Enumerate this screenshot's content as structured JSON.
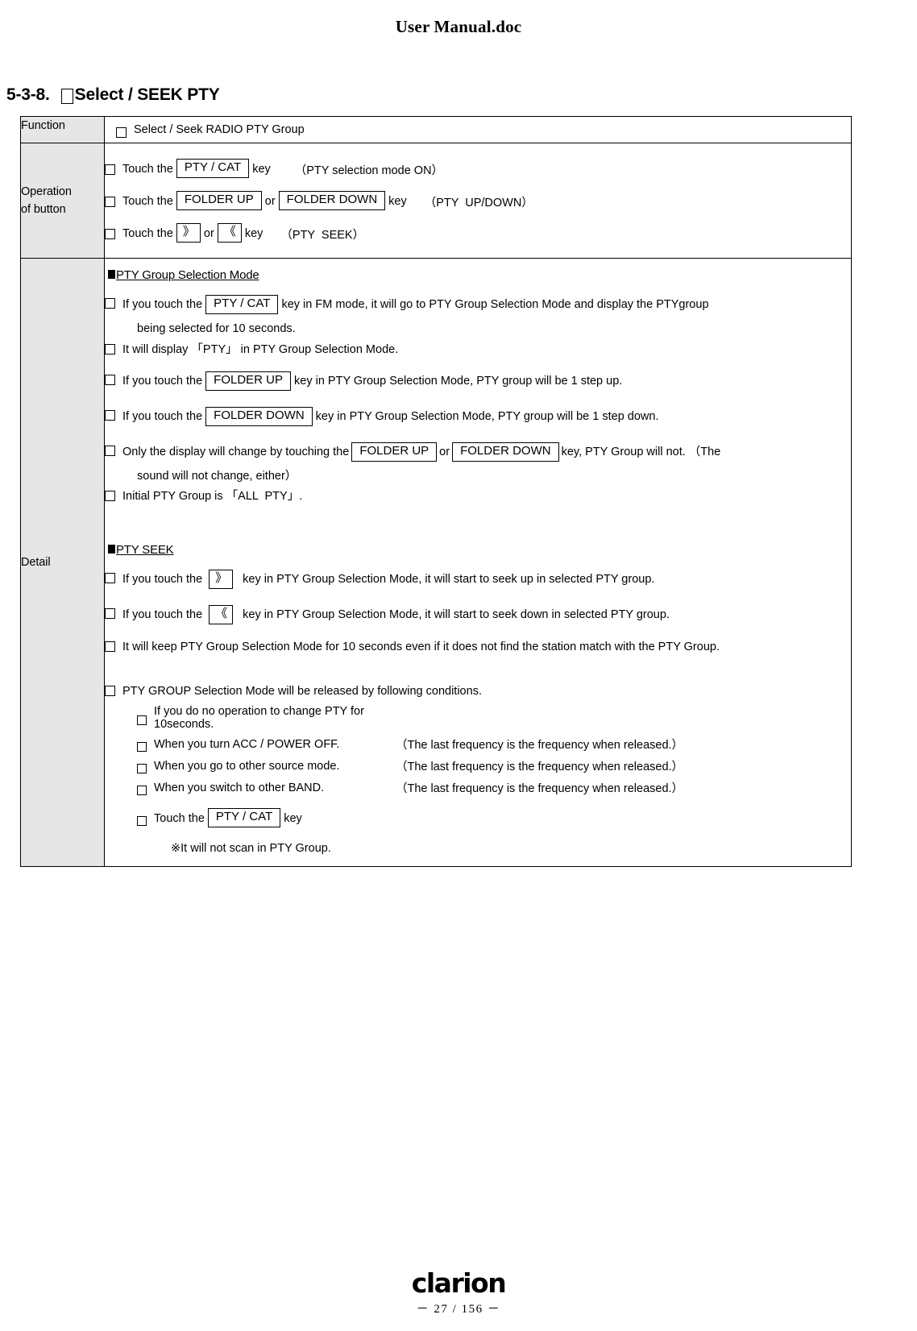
{
  "document": {
    "header_title": "User Manual.doc"
  },
  "section": {
    "number": "5-3-8.",
    "title": "Select / SEEK  PTY"
  },
  "table": {
    "rows": {
      "function": {
        "label": "Function",
        "value": "Select / Seek RADIO PTY Group"
      },
      "operation": {
        "label_line1": "Operation",
        "label_line2": "of button",
        "items": [
          {
            "prefix": "Touch the",
            "key1": "PTY / CAT",
            "mid": "",
            "key2": "",
            "suffix": "key",
            "note": "（PTY selection mode ON）"
          },
          {
            "prefix": "Touch the",
            "key1": "FOLDER UP",
            "mid": "or",
            "key2": "FOLDER DOWN",
            "suffix": "key",
            "note": "（PTY  UP/DOWN）"
          },
          {
            "prefix": "Touch the",
            "key1": "》",
            "mid": "or",
            "key2": "《",
            "suffix": "key",
            "note": "（PTY  SEEK）"
          }
        ]
      },
      "detail": {
        "label": "Detail",
        "group_heading": "PTY Group Selection Mode",
        "group_items": {
          "item1_a": "If you touch the",
          "item1_key": "PTY / CAT",
          "item1_b": "key in FM mode, it will go to PTY Group Selection Mode and display the PTYgroup",
          "item1_cont": "being selected for 10 seconds.",
          "item2": "It will display 「PTY」 in PTY Group Selection Mode.",
          "item3_a": "If you touch the",
          "item3_key": "FOLDER UP",
          "item3_b": "key in PTY Group Selection Mode, PTY group will be 1 step up.",
          "item4_a": "If you touch the",
          "item4_key": "FOLDER DOWN",
          "item4_b": "key in PTY Group Selection Mode, PTY group will be 1 step down.",
          "item5_a": "Only the display will change by touching the",
          "item5_key1": "FOLDER UP",
          "item5_mid": "or",
          "item5_key2": "FOLDER DOWN",
          "item5_b": "key,   PTY Group will not. （The",
          "item5_cont": "sound will not change, either）",
          "item6": "Initial PTY Group is 「ALL  PTY」."
        },
        "seek_heading": "PTY  SEEK",
        "seek_items": {
          "item1_a": "If you touch the",
          "item1_key": "》",
          "item1_b": "key in PTY Group Selection Mode, it will start to seek up in selected PTY group.",
          "item2_a": "If you touch the",
          "item2_key": "《",
          "item2_b": "key in PTY Group Selection Mode, it will start to seek down in selected PTY group.",
          "item3": "It will keep PTY Group Selection Mode for 10 seconds even if it does not find the station match with the PTY Group.",
          "item4": "PTY GROUP Selection Mode will be released by following conditions."
        },
        "release_conditions": [
          {
            "text": "If you do no operation to change PTY for 10seconds.",
            "note": ""
          },
          {
            "text": "When you turn ACC / POWER  OFF.",
            "note": "（The last frequency is the frequency when released.）"
          },
          {
            "text": "When you go to other source mode.",
            "note": "（The last frequency is the frequency when released.）"
          },
          {
            "text": "When you switch to other BAND.",
            "note": "（The last frequency is the frequency when released.）"
          }
        ],
        "release_touch": {
          "prefix": "Touch the",
          "key": "PTY / CAT",
          "suffix": "key"
        },
        "final_note": "※It will not scan in PTY Group."
      }
    }
  },
  "footer": {
    "brand": "clarion",
    "page_number": "－ 27 / 156 －"
  }
}
